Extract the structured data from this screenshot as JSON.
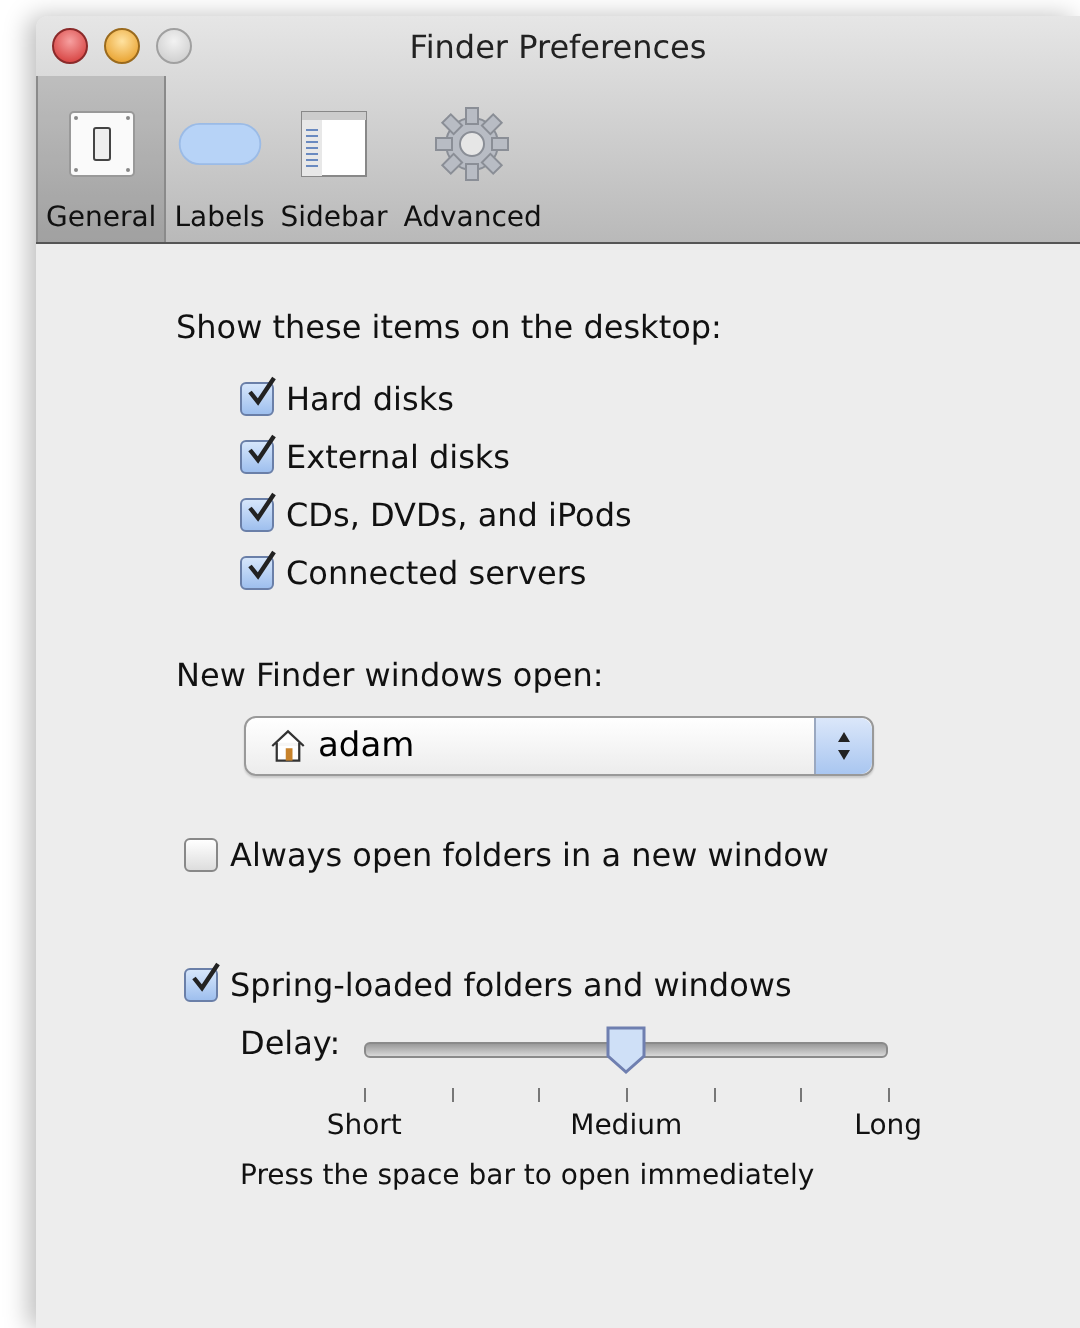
{
  "window": {
    "title": "Finder Preferences"
  },
  "toolbar": [
    {
      "label": "General",
      "kind": "general",
      "selected": true
    },
    {
      "label": "Labels",
      "kind": "labels",
      "selected": false
    },
    {
      "label": "Sidebar",
      "kind": "sidebar",
      "selected": false
    },
    {
      "label": "Advanced",
      "kind": "advanced",
      "selected": false
    }
  ],
  "desktop_items": {
    "heading": "Show these items on the desktop:",
    "items": [
      {
        "label": "Hard disks",
        "checked": true
      },
      {
        "label": "External disks",
        "checked": true
      },
      {
        "label": "CDs, DVDs, and iPods",
        "checked": true
      },
      {
        "label": "Connected servers",
        "checked": true
      }
    ]
  },
  "new_windows": {
    "label": "New Finder windows open:",
    "value": "adam"
  },
  "always_open": {
    "label": "Always open folders in a new window",
    "checked": false
  },
  "spring_loaded": {
    "label": "Spring-loaded folders and windows",
    "checked": true
  },
  "delay": {
    "label": "Delay:",
    "level": 0.5,
    "tick_labels": [
      "Short",
      "Medium",
      "Long"
    ]
  },
  "hint": "Press the space bar to open immediately"
}
